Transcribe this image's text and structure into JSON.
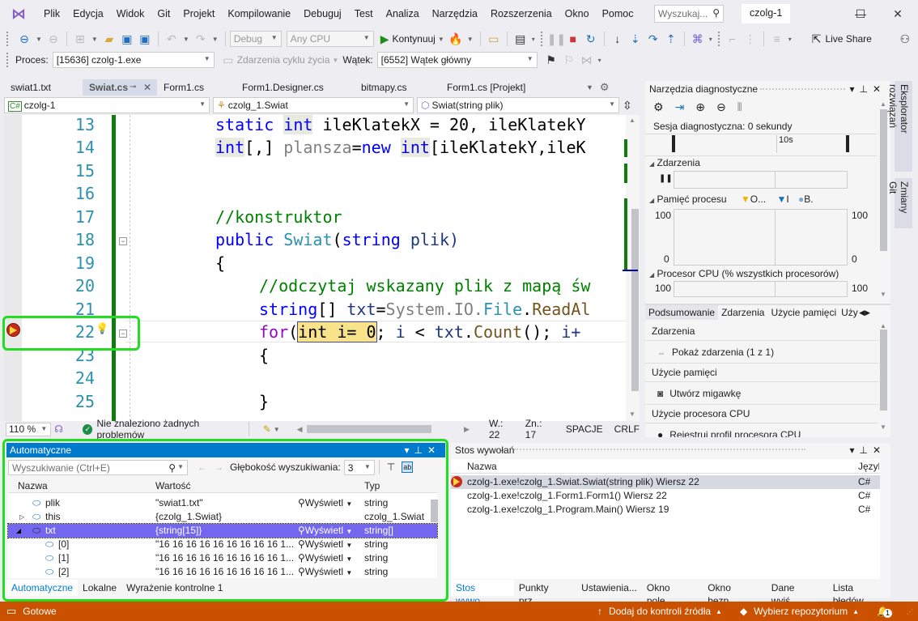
{
  "titlebar": {
    "menu": [
      "Plik",
      "Edycja",
      "Widok",
      "Git",
      "Projekt",
      "Kompilowanie",
      "Debuguj",
      "Test",
      "Analiza",
      "Narzędzia",
      "Rozszerzenia",
      "Okno",
      "Pomoc"
    ],
    "search_placeholder": "Wyszukaj...",
    "solution_name": "czolg-1",
    "minimize": "—",
    "maximize": "☐",
    "close": "✕"
  },
  "toolbar1": {
    "config": "Debug",
    "platform": "Any CPU",
    "continue_label": "Kontynuuj",
    "live_share_label": "Live Share"
  },
  "toolbar2": {
    "process_label": "Proces:",
    "process_value": "[15636] czolg-1.exe",
    "lifecycle_label": "Zdarzenia cyklu życia",
    "thread_label": "Wątek:",
    "thread_value": "[6552] Wątek główny"
  },
  "doc_tabs": [
    {
      "label": "swiat1.txt"
    },
    {
      "label": "Swiat.cs",
      "active": true
    },
    {
      "label": "Form1.cs"
    },
    {
      "label": "Form1.Designer.cs"
    },
    {
      "label": "bitmapy.cs"
    },
    {
      "label": "Form1.cs [Projekt]"
    }
  ],
  "navbar": {
    "project": "czolg-1",
    "class": "czolg_1.Swiat",
    "member": "Swiat(string plik)"
  },
  "editor": {
    "line_numbers": [
      "13",
      "14",
      "15",
      "16",
      "17",
      "18",
      "19",
      "20",
      "21",
      "22",
      "23",
      "24",
      "25"
    ],
    "current_line": "22",
    "lines": {
      "l13": {
        "a": "static ",
        "b": "int",
        "c": " ileKlatekX = 20, ileKlatekY"
      },
      "l14": {
        "a": "int",
        "b": "[,] ",
        "c": "plansza",
        "d": "=",
        "e": "new ",
        "f": "int",
        "g": "[ileKlatekY,ileK"
      },
      "l17": "//konstruktor",
      "l18": {
        "a": "public ",
        "b": "Swiat",
        "c": "(",
        "d": "string ",
        "e": "plik)"
      },
      "l19": "{",
      "l20": "//odczytaj wskazany plik z mapą św",
      "l21": {
        "a": "string",
        "b": "[] ",
        "c": "txt",
        "d": "=",
        "e": "System.IO.",
        "f": "File",
        "g": ".",
        "h": "ReadAl"
      },
      "l22": {
        "a": "for",
        "b": "(",
        "c": "int i= 0",
        "d": "; ",
        "e": "i",
        " f": " < ",
        "g": "txt",
        "h": ".",
        "i": "Count",
        "j": "(); ",
        "k": "i+"
      },
      "l23": "{",
      "l25": "}"
    }
  },
  "editor_status": {
    "zoom": "110 %",
    "issues": "Nie znaleziono żadnych problemów",
    "line": "W.: 22",
    "col": "Zn.: 17",
    "spaces": "SPACJE",
    "eol": "CRLF"
  },
  "diagnostics": {
    "title": "Narzędzia diagnostyczne",
    "session": "Sesja diagnostyczna: 0 sekundy",
    "timeline_label": "10s",
    "events_label": "Zdarzenia",
    "memory_label": "Pamięć procesu",
    "legend": [
      "O...",
      "I",
      "B."
    ],
    "mem_max": "100",
    "mem_min": "0",
    "cpu_label": "Procesor CPU (% wszystkich procesorów)",
    "cpu_max": "100",
    "tabs": [
      "Podsumowanie",
      "Zdarzenia",
      "Użycie pamięci",
      "Uży"
    ],
    "sections": [
      {
        "header": "Zdarzenia",
        "item": "Pokaż zdarzenia (1 z 1)"
      },
      {
        "header": "Użycie pamięci",
        "item": "Utwórz migawkę"
      },
      {
        "header": "Użycie procesora CPU",
        "item": "Rejestruj profil procesora CPU"
      }
    ]
  },
  "side_tabs": [
    "Eksplorator rozwiązań",
    "Zmiany Git"
  ],
  "autos": {
    "title": "Automatyczne",
    "search_placeholder": "Wyszukiwanie (Ctrl+E)",
    "depth_label": "Głębokość wyszukiwania:",
    "depth_value": "3",
    "columns": [
      "Nazwa",
      "Wartość",
      "Typ"
    ],
    "rows": [
      {
        "name": "plik",
        "value": "\"swiat1.txt\"",
        "view": "Wyświetl",
        "type": "string"
      },
      {
        "name": "this",
        "value": "{czolg_1.Swiat}",
        "view": "",
        "type": "czolg_1.Swiat"
      },
      {
        "name": "txt",
        "value": "{string[15]}",
        "view": "Wyświetl",
        "type": "string[]"
      },
      {
        "name": "[0]",
        "value": "\"16 16 16 16 16 16 16 16 16 1...",
        "view": "Wyświetl",
        "type": "string"
      },
      {
        "name": "[1]",
        "value": "\"16 16 16 16 16 16 16 16 16 1...",
        "view": "Wyświetl",
        "type": "string"
      },
      {
        "name": "[2]",
        "value": "\"16 16 16 16 16 16 16 16 16 1...",
        "view": "Wyświetl",
        "type": "string"
      }
    ],
    "tabs": [
      "Automatyczne",
      "Lokalne",
      "Wyrażenie kontrolne 1"
    ]
  },
  "callstack": {
    "title": "Stos wywołań",
    "columns": [
      "Nazwa",
      "Język"
    ],
    "rows": [
      {
        "name": "czolg-1.exe!czolg_1.Swiat.Swiat(string plik) Wiersz 22",
        "lang": "C#"
      },
      {
        "name": "czolg-1.exe!czolg_1.Form1.Form1() Wiersz 22",
        "lang": "C#"
      },
      {
        "name": "czolg-1.exe!czolg_1.Program.Main() Wiersz 19",
        "lang": "C#"
      }
    ],
    "tabs": [
      "Stos wywo...",
      "Punkty prz...",
      "Ustawienia...",
      "Okno pole...",
      "Okno bezp...",
      "Dane wyjś...",
      "Lista błędów"
    ]
  },
  "statusbar": {
    "ready": "Gotowe",
    "source_control": "Dodaj do kontroli źródła",
    "repo": "Wybierz repozytorium",
    "notifications": "1"
  },
  "colors": {
    "accent": "#007acc",
    "status_bar": "#ca5100",
    "selection": "#7367f0",
    "highlight_box": "#22dd22"
  }
}
